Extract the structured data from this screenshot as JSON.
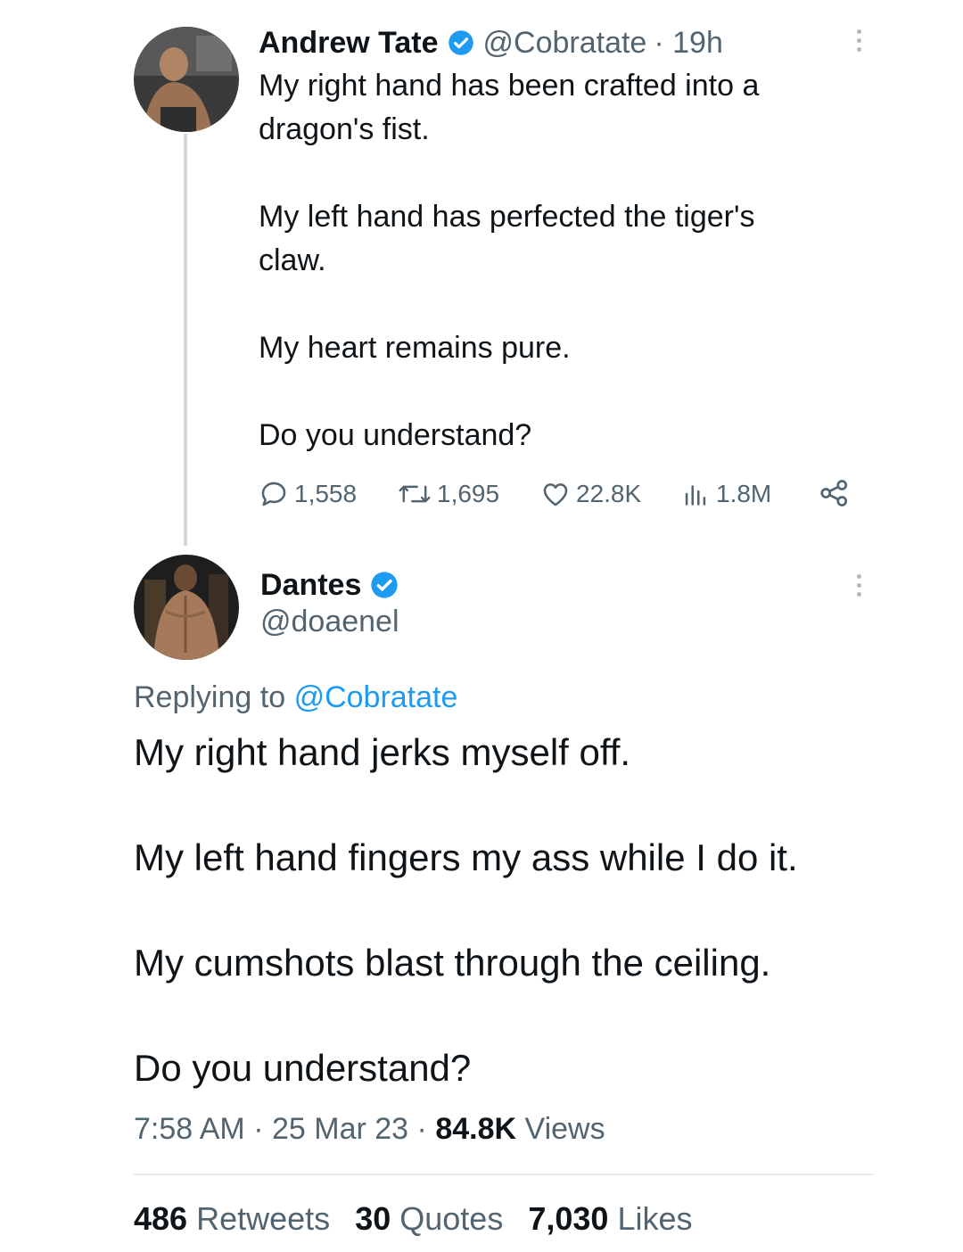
{
  "tweet1": {
    "name": "Andrew Tate",
    "handle": "@Cobratate",
    "time": "· 19h",
    "paragraphs": [
      "My right hand has been crafted into a",
      "dragon's fist.",
      "My left hand has perfected the tiger's",
      "claw.",
      "My heart remains pure.",
      "Do you understand?"
    ],
    "stats": {
      "replies": "1,558",
      "retweets": "1,695",
      "likes": "22.8K",
      "views": "1.8M"
    }
  },
  "tweet2": {
    "name": "Dantes",
    "handle": "@doaenel",
    "replying_prefix": "Replying to",
    "replying_handle": "@Cobratate",
    "paragraphs": [
      "My right hand jerks myself off.",
      "My left hand fingers my ass while I do it.",
      "My cumshots blast through the ceiling.",
      "Do you understand?"
    ],
    "time": "7:58 AM",
    "date": "25 Mar 23",
    "views_count": "84.8K",
    "views_label": "Views",
    "retweets_count": "486",
    "retweets_label": "Retweets",
    "quotes_count": "30",
    "quotes_label": "Quotes",
    "likes_count": "7,030",
    "likes_label": "Likes"
  },
  "colors": {
    "verified": "#1d9bf0",
    "link": "#1d9bf0",
    "secondary": "#536471"
  },
  "icons": [
    "verified-badge-icon",
    "reply-icon",
    "retweet-icon",
    "like-icon",
    "views-icon",
    "share-icon",
    "more-icon"
  ]
}
